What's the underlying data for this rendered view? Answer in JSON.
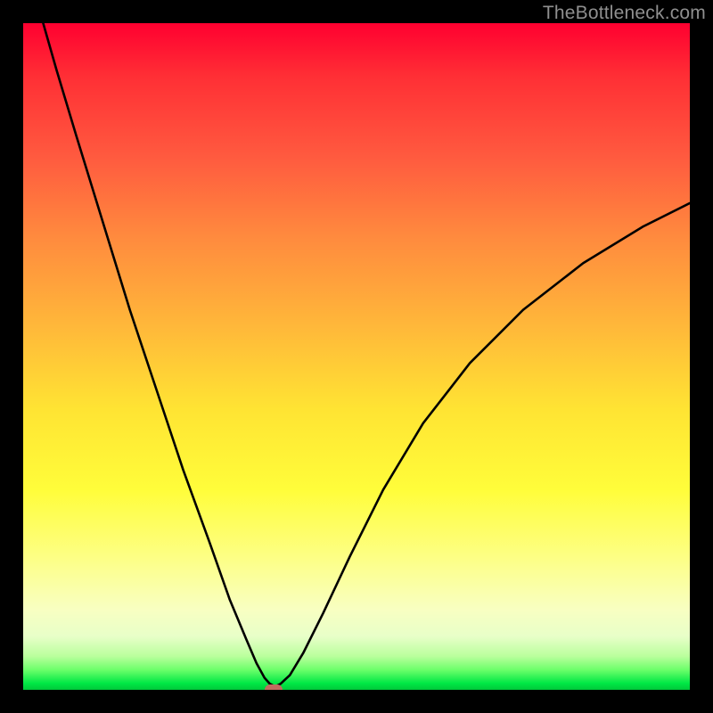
{
  "watermark": {
    "text": "TheBottleneck.com"
  },
  "chart_data": {
    "type": "line",
    "title": "",
    "xlabel": "",
    "ylabel": "",
    "xlim": [
      0,
      100
    ],
    "ylim": [
      0,
      100
    ],
    "grid": false,
    "legend": null,
    "background_gradient": {
      "direction": "vertical",
      "stops": [
        {
          "pos": 0.0,
          "color": "#ff0030"
        },
        {
          "pos": 0.2,
          "color": "#ff5a3f"
        },
        {
          "pos": 0.45,
          "color": "#ffb63a"
        },
        {
          "pos": 0.7,
          "color": "#fffd3a"
        },
        {
          "pos": 0.88,
          "color": "#f8ffc2"
        },
        {
          "pos": 0.97,
          "color": "#6cff6a"
        },
        {
          "pos": 1.0,
          "color": "#00c93a"
        }
      ]
    },
    "series": [
      {
        "name": "bottleneck-curve",
        "type": "line",
        "color": "#000000",
        "x": [
          3.0,
          5.0,
          8.0,
          12.0,
          16.0,
          20.0,
          24.0,
          28.0,
          31.0,
          33.5,
          35.0,
          36.2,
          37.0,
          37.8,
          38.6,
          40.0,
          42.0,
          45.0,
          49.0,
          54.0,
          60.0,
          67.0,
          75.0,
          84.0,
          93.0,
          100.0
        ],
        "y": [
          100.0,
          93.0,
          83.0,
          70.0,
          57.0,
          45.0,
          33.0,
          22.0,
          13.5,
          7.5,
          4.0,
          1.8,
          0.9,
          0.5,
          0.9,
          2.2,
          5.5,
          11.5,
          20.0,
          30.0,
          40.0,
          49.0,
          57.0,
          64.0,
          69.5,
          73.0
        ]
      }
    ],
    "marker": {
      "name": "optimal-point",
      "x": 37.5,
      "y": 0.0,
      "color": "#c26a5f",
      "shape": "rounded-rect"
    }
  }
}
